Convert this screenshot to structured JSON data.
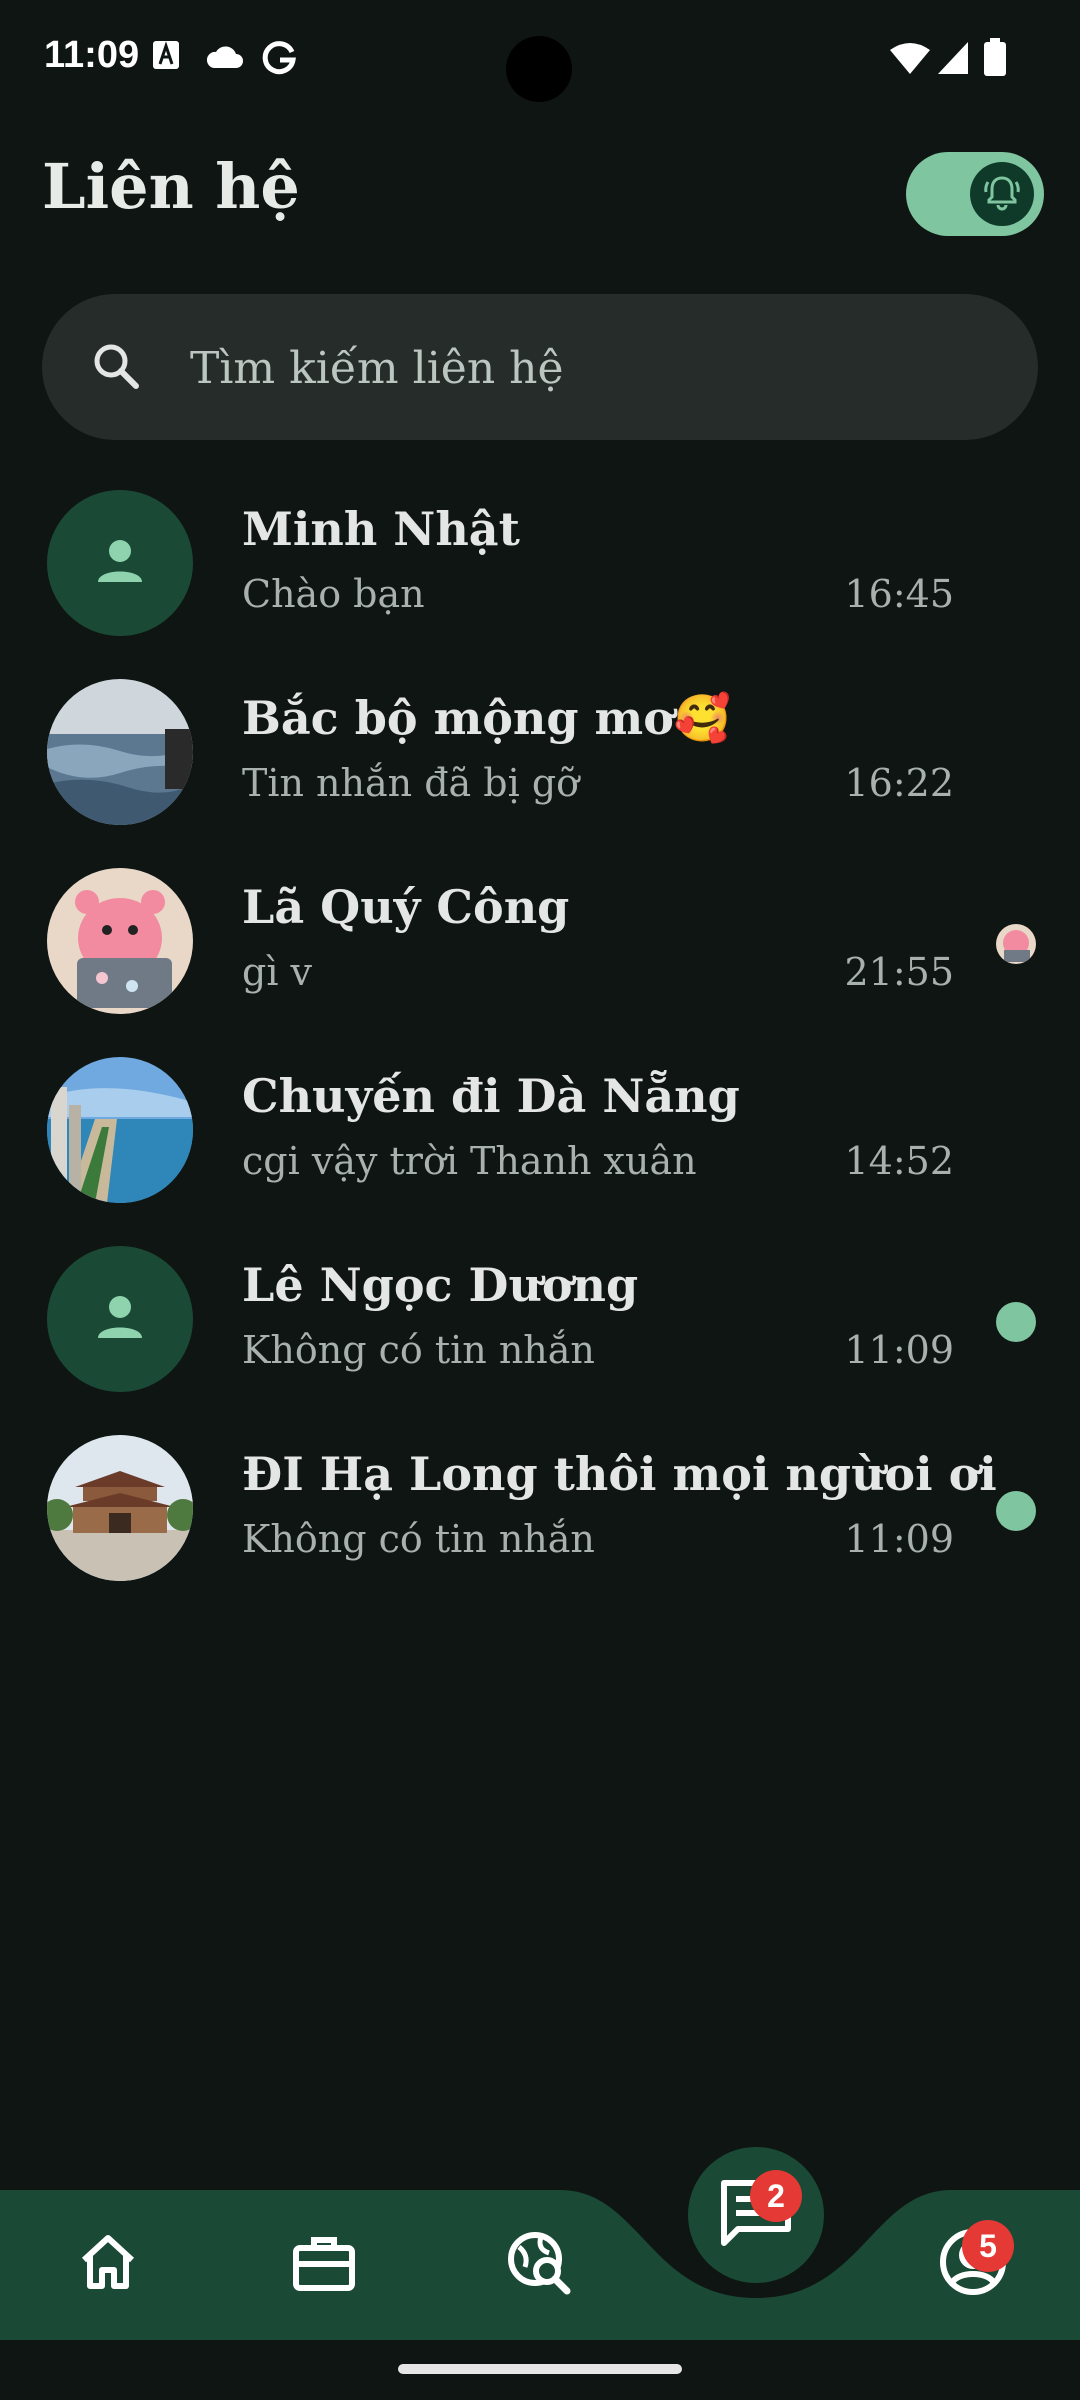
{
  "status_bar": {
    "time": "11:09",
    "icons": [
      "a-icon",
      "cloud-icon",
      "google-icon",
      "wifi-icon",
      "signal-icon",
      "battery-icon"
    ]
  },
  "header": {
    "title": "Liên hệ",
    "notification_toggle_on": true
  },
  "search": {
    "placeholder": "Tìm kiếm liên hệ"
  },
  "contacts": [
    {
      "name": "Minh Nhật",
      "last_message": "Chào bạn",
      "time": "16:45",
      "avatar": "default-person",
      "indicator": "none"
    },
    {
      "name": "Bắc bộ mộng mơ🥰",
      "last_message": "Tin nhắn đã bị gỡ",
      "time": "16:22",
      "avatar": "sea-photo",
      "indicator": "none"
    },
    {
      "name": "Lã Quý Công",
      "last_message": "gì v",
      "time": "21:55",
      "avatar": "pink-toy-photo",
      "indicator": "seen-avatar"
    },
    {
      "name": "Chuyến đi Dà Nẵng",
      "last_message": "cgi vậy trời Thanh xuân",
      "time": "14:52",
      "avatar": "beach-city-photo",
      "indicator": "none"
    },
    {
      "name": "Lê Ngọc Dương",
      "last_message": "Không có tin nhắn",
      "time": "11:09",
      "avatar": "default-person",
      "indicator": "dot"
    },
    {
      "name": "ĐI Hạ Long thôi mọi ngừoi ơi",
      "last_message": "Không có tin nhắn",
      "time": "11:09",
      "avatar": "temple-photo",
      "indicator": "dot"
    }
  ],
  "bottom_nav": {
    "items": [
      "home-icon",
      "briefcase-icon",
      "explore-icon",
      "chat-icon",
      "profile-icon"
    ],
    "chat_badge": "2",
    "profile_badge": "5"
  },
  "colors": {
    "background": "#0f1513",
    "nav": "#1a4a35",
    "accent": "#7fc5a0",
    "badge": "#e53935"
  }
}
